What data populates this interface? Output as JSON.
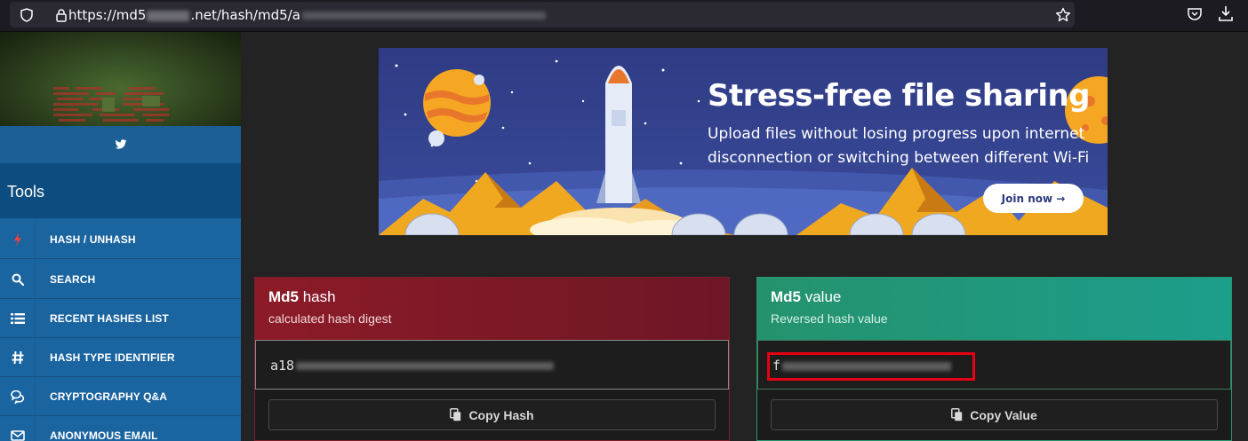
{
  "browser": {
    "url_prefix": "https://md5",
    "url_domain_suffix": ".net/hash/md5/a"
  },
  "sidebar": {
    "tools_title": "Tools",
    "items": [
      {
        "label": "HASH / UNHASH",
        "icon": "bolt-icon"
      },
      {
        "label": "SEARCH",
        "icon": "search-icon"
      },
      {
        "label": "RECENT HASHES LIST",
        "icon": "list-icon"
      },
      {
        "label": "HASH TYPE IDENTIFIER",
        "icon": "hash-icon"
      },
      {
        "label": "CRYPTOGRAPHY Q&A",
        "icon": "chat-icon"
      },
      {
        "label": "ANONYMOUS EMAIL",
        "icon": "envelope-icon"
      }
    ]
  },
  "ad": {
    "headline": "Stress-free file sharing",
    "body": "Upload files without losing progress upon internet disconnection or switching between different Wi-Fi",
    "cta": "Join now →"
  },
  "hash_panel": {
    "title_bold": "Md5",
    "title_rest": " hash",
    "subtitle": "calculated hash digest",
    "value_visible": "a18",
    "copy_label": "Copy Hash"
  },
  "value_panel": {
    "title_bold": "Md5",
    "title_rest": " value",
    "subtitle": "Reversed hash value",
    "value_visible": "f",
    "copy_label": "Copy Value"
  },
  "colors": {
    "hash_header": "#8c1b27",
    "value_header": "#25926d",
    "sidebar": "#1a64a0",
    "highlight": "#e60012"
  }
}
